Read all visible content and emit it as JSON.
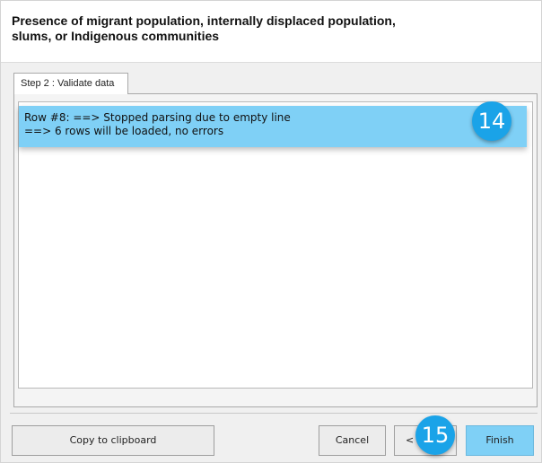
{
  "dialog": {
    "title_line1": "Presence of migrant population, internally displaced population,",
    "title_line2": "slums, or Indigenous communities"
  },
  "tabs": [
    {
      "label": "Step 2 : Validate data"
    }
  ],
  "log": {
    "line1": "Row #8: ==> Stopped parsing due to empty line",
    "line2": "==> 6 rows will be loaded, no errors"
  },
  "callouts": {
    "badge_14": "14",
    "badge_15": "15"
  },
  "buttons": {
    "copy": "Copy to clipboard",
    "cancel": "Cancel",
    "back": "<",
    "finish": "Finish"
  },
  "colors": {
    "highlight": "#7fd0f6",
    "badge": "#1aa3e8"
  }
}
